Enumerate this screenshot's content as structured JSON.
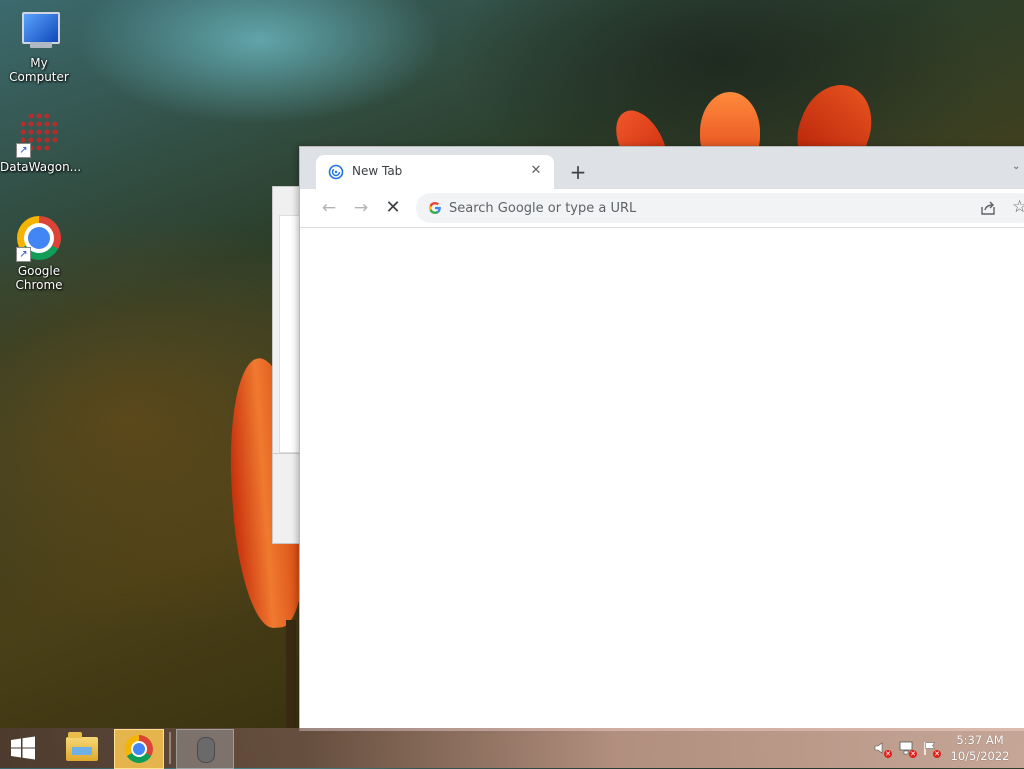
{
  "desktop": {
    "icons": [
      {
        "label": "My Computer",
        "icon": "computer-icon"
      },
      {
        "label": "DataWagon...",
        "icon": "datawagon-icon"
      },
      {
        "label": "Google Chrome",
        "icon": "chrome-icon"
      }
    ]
  },
  "browser": {
    "tab": {
      "title": "New Tab",
      "close": "✕",
      "favicon": "loading-favicon-icon"
    },
    "new_tab_symbol": "+",
    "tabstrip_menu_symbol": "⌄",
    "nav": {
      "back": "←",
      "forward": "→",
      "stop": "✕"
    },
    "omnibox": {
      "placeholder": "Search Google or type a URL",
      "value": ""
    },
    "star_symbol": "☆"
  },
  "taskbar": {
    "pinned": [
      {
        "name": "File Explorer",
        "icon": "file-explorer-icon"
      },
      {
        "name": "Google Chrome",
        "icon": "chrome-icon",
        "active": true
      },
      {
        "name": "Mouse",
        "icon": "mouse-icon"
      }
    ],
    "tray": {
      "volume": "volume-muted-icon",
      "network": "network-disconnected-icon",
      "action_center": "action-center-flag-icon"
    },
    "clock": {
      "time": "5:37 AM",
      "date": "10/5/2022"
    }
  },
  "colors": {
    "chrome_red": "#db4437",
    "chrome_green": "#0f9d58",
    "chrome_yellow": "#f4b400",
    "chrome_blue": "#4285f4",
    "tabstrip_bg": "#dee1e6",
    "omnibox_bg": "#f1f3f4"
  }
}
